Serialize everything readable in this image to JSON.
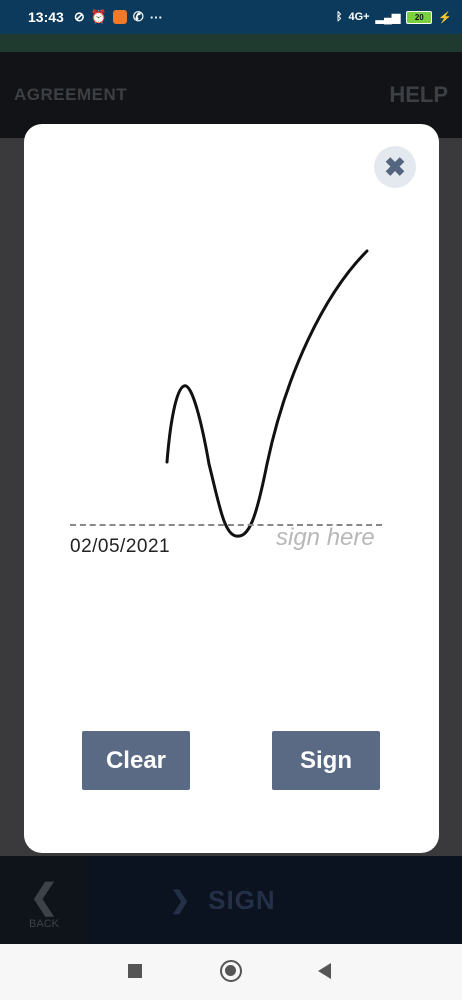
{
  "status_bar": {
    "time": "13:43",
    "network": "4G+",
    "battery": "20"
  },
  "app_header": {
    "title": "AGREEMENT",
    "help": "HELP"
  },
  "app_footer": {
    "back_label": "BACK",
    "sign_label": "SIGN"
  },
  "modal": {
    "date": "02/05/2021",
    "hint": "sign here",
    "clear_label": "Clear",
    "sign_label": "Sign"
  },
  "colors": {
    "button": "#5a6a84",
    "close_bg": "#e4e8ef",
    "status_bar": "#0c3a5c"
  }
}
